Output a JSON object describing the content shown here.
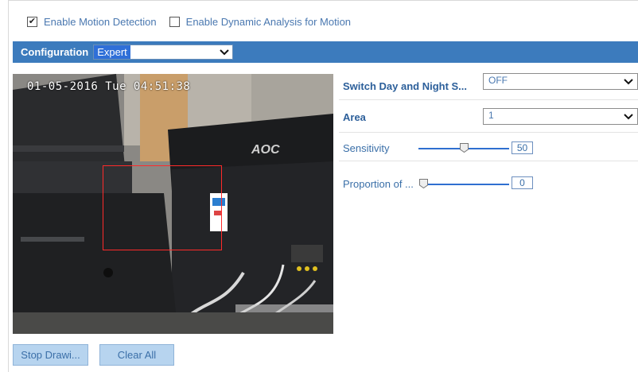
{
  "checkboxes": [
    {
      "label": "Enable Motion Detection",
      "checked": true
    },
    {
      "label": "Enable Dynamic Analysis for Motion",
      "checked": false
    }
  ],
  "config": {
    "label": "Configuration",
    "value": "Expert"
  },
  "video": {
    "osd": "01-05-2016 Tue 04:51:38"
  },
  "settings": {
    "switch_day_night": {
      "label": "Switch Day and Night S...",
      "value": "OFF"
    },
    "area": {
      "label": "Area",
      "value": "1"
    },
    "sensitivity": {
      "label": "Sensitivity",
      "value": "50"
    },
    "proportion": {
      "label": "Proportion of ...",
      "value": "0"
    }
  },
  "buttons": {
    "stop_drawing": "Stop Drawi...",
    "clear_all": "Clear All"
  },
  "colors": {
    "accent_bar": "#3c7bbd",
    "button_bg": "#b7d4ef",
    "motion_rect": "#ff2a2a"
  }
}
